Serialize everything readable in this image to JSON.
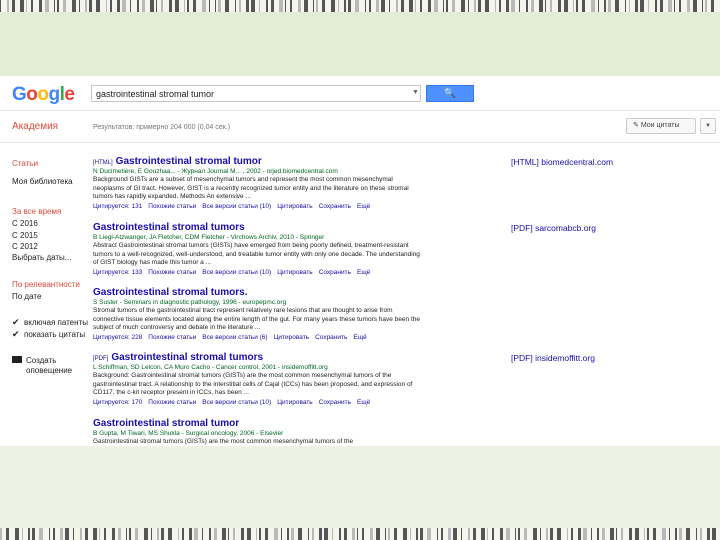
{
  "logo": {
    "text": "Google",
    "letters": [
      "G",
      "o",
      "o",
      "g",
      "l",
      "e"
    ]
  },
  "search": {
    "value": "gastrointestinal stromal tumor"
  },
  "academy": "Академия",
  "results_count": "Результатов: примерно 204 000 (0,04 сек.)",
  "my_citations": "Мои цитаты",
  "sidebar": {
    "articles": "Статьи",
    "my_library": "Моя библиотека",
    "any_time": "За все время",
    "since_2016": "С 2016",
    "since_2015": "С 2015",
    "since_2012": "С 2012",
    "choose_dates": "Выбрать даты...",
    "by_relevance": "По релевантности",
    "by_date": "По дате",
    "include_patents": "включая патенты",
    "show_citations": "показать цитаты",
    "create_alert": "Создать оповещение"
  },
  "results": [
    {
      "format": "[HTML]",
      "title": "Gastrointestinal stromal tumor",
      "meta": "N Ducimetière, E Gouzhaa... - Журнал Journal M... , 2002 - orjed.biomedcentral.com",
      "snippet": "Background GISTs are a subset of mesenchymal tumors and represent the most common mesenchymal neoplasms of GI tract. However, GIST is a recently recognized tumor entity and the literature on these stromal tumors has rapidly expanded. Methods An extensive ...",
      "links": [
        "Цитируется: 131",
        "Похожие статьи",
        "Все версии статьи (10)",
        "Цитировать",
        "Сохранить",
        "Ещё"
      ],
      "side": "[HTML] biomedcentral.com"
    },
    {
      "format": "",
      "title": "Gastrointestinal stromal tumors",
      "meta": "B Liegl-Atzwanger, JA Fletcher, CDM Fletcher - Virchows Archiv, 2010 - Springer",
      "snippet": "Abstract Gastrointestinal stromal tumors (GISTs) have emerged from being poorly defined, treatment-resistant tumors to a well-recognized, well-understood, and treatable tumor entity with only one decade. The understanding of GIST biology has made this tumor a ...",
      "links": [
        "Цитируется: 133",
        "Похожие статьи",
        "Все версии статьи (10)",
        "Цитировать",
        "Сохранить",
        "Ещё"
      ],
      "side": "[PDF] sarcomabcb.org"
    },
    {
      "format": "",
      "title": "Gastrointestinal stromal tumors.",
      "meta": "S Suster - Seminars in diagnostic pathology, 1996 - europepmc.org",
      "snippet": "Stromal tumors of the gastrointestinal tract represent relatively rare lesions that are thought to arise from connective tissue elements located along the entire length of the gut. For many years these tumors have been the subject of much controversy and debate in the literature ...",
      "links": [
        "Цитируется: 228",
        "Похожие статьи",
        "Все версии статьи (6)",
        "Цитировать",
        "Сохранить",
        "Ещё"
      ],
      "side": ""
    },
    {
      "format": "[PDF]",
      "title": "Gastrointestinal stromal tumors",
      "meta": "L Schiffman, SD Lelcon, CA Muro Cacho - Cancer control, 2001 - insidemoffitt.org",
      "snippet": "Background: Gastrointestinal stromal tumors (GISTs) are the most common mesenchymal tumors of the gastrointestinal tract. A relationship to the interstitial cells of Cajal (ICCs) has been proposed, and expression of CD117, the c-kit receptor present in ICCs, has been ...",
      "links": [
        "Цитируется: 170",
        "Похожие статьи",
        "Все версии статьи (10)",
        "Цитировать",
        "Сохранить",
        "Ещё"
      ],
      "side": "[PDF] insidemoffitt.org"
    },
    {
      "format": "",
      "title": "Gastrointestinal stromal tumor",
      "meta": "B Gupta, M Tiwari, MS Shukla - Surgical oncology, 2006 - Elsevier",
      "snippet": "Gastrointestinal stromal tumors (GISTs) are the most common mesenchymal tumors of the",
      "links": [],
      "side": ""
    }
  ],
  "colors": {
    "link": "#1a0dab",
    "meta": "#006621",
    "accent": "#dd4b39",
    "button": "#4d90fe"
  }
}
